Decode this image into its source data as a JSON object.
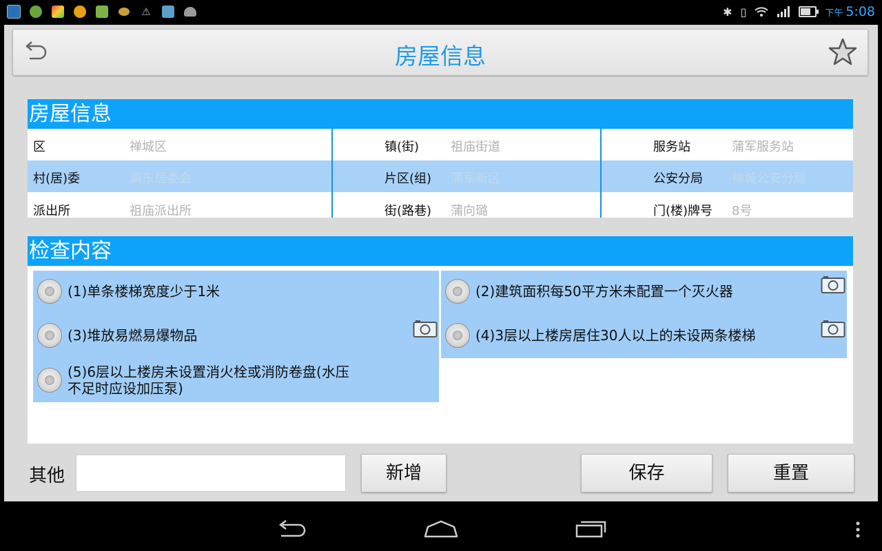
{
  "status_bar": {
    "ampm": "下午",
    "time": "5:08",
    "left_icons": [
      "app-icon",
      "app-icon",
      "app-icon",
      "update-icon",
      "app-icon",
      "app-icon",
      "warning-icon",
      "app-icon",
      "android-icon"
    ],
    "right_icons": [
      "bluetooth-icon",
      "vibrate-icon",
      "wifi-icon",
      "signal-icon",
      "battery-icon"
    ]
  },
  "header": {
    "title": "房屋信息",
    "back_icon": "back-icon",
    "favorite_icon": "star-icon"
  },
  "house_info": {
    "section_title": "房屋信息",
    "rows": [
      [
        {
          "label": "区",
          "value": "禅城区"
        },
        {
          "label": "镇(街)",
          "value": "祖庙街道"
        },
        {
          "label": "服务站",
          "value": "蒲军服务站"
        }
      ],
      [
        {
          "label": "村(居)委",
          "value": "满东居委会"
        },
        {
          "label": "片区(组)",
          "value": "蒲军新区"
        },
        {
          "label": "公安分局",
          "value": "禅城公安分局"
        }
      ],
      [
        {
          "label": "派出所",
          "value": "祖庙派出所"
        },
        {
          "label": "街(路巷)",
          "value": "蒲向璐"
        },
        {
          "label": "门(楼)牌号",
          "value": "8号"
        }
      ]
    ]
  },
  "inspection": {
    "section_title": "检查内容",
    "items": [
      {
        "text": "(1)单条楼梯宽度少于1米",
        "selected": false
      },
      {
        "text": "(2)建筑面积每50平方米未配置一个灭火器",
        "selected": false
      },
      {
        "text": "(3)堆放易燃易爆物品",
        "selected": false
      },
      {
        "text": "(4)3层以上楼房居住30人以上的未设两条楼梯",
        "selected": false
      },
      {
        "text": "(5)6层以上楼房未设置消火栓或消防卷盘(水压",
        "text_line2": "不足时应设加压泵)",
        "selected": false
      }
    ]
  },
  "bottom": {
    "other_label": "其他",
    "other_value": "",
    "add_button": "新增",
    "save_button": "保存",
    "reset_button": "重置"
  },
  "colors": {
    "accent": "#0da3fb",
    "title_blue": "#1e9be6",
    "row_highlight": "#a8d2f7",
    "item_bg": "#9fcdf7"
  }
}
